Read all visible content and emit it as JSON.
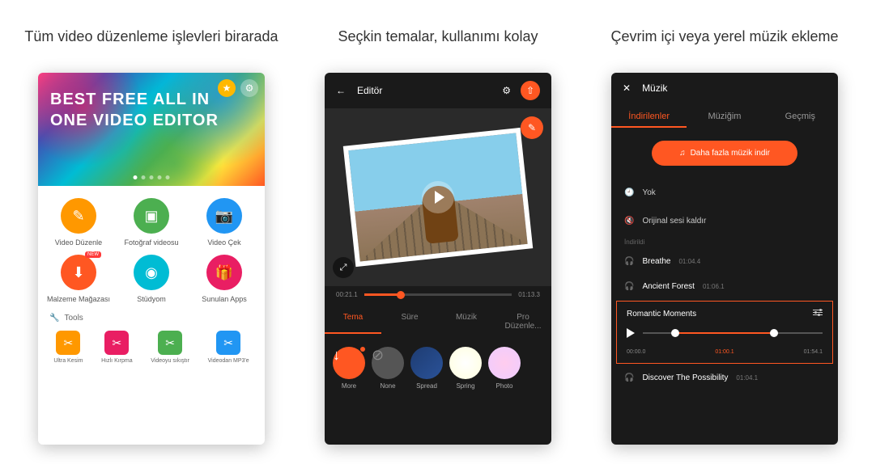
{
  "captions": {
    "c1": "Tüm video düzenleme işlevleri birarada",
    "c2": "Seçkin temalar, kullanımı kolay",
    "c3": "Çevrim içi veya yerel müzik ekleme"
  },
  "screen1": {
    "hero_line1": "BEST FREE ALL IN",
    "hero_line2": "ONE VIDEO EDITOR",
    "tiles": [
      {
        "label": "Video Düzenle",
        "color": "#ff9800",
        "icon": "pencil"
      },
      {
        "label": "Fotoğraf videosu",
        "color": "#4caf50",
        "icon": "image"
      },
      {
        "label": "Video Çek",
        "color": "#2196f3",
        "icon": "camera"
      },
      {
        "label": "Malzeme Mağazası",
        "color": "#ff5722",
        "icon": "download",
        "new": "NEW"
      },
      {
        "label": "Stüdyom",
        "color": "#00bcd4",
        "icon": "reel"
      },
      {
        "label": "Sunulan Apps",
        "color": "#e91e63",
        "icon": "gift"
      }
    ],
    "tools_header": "Tools",
    "tools": [
      {
        "label": "Ultra Kesim",
        "color": "#ff9800"
      },
      {
        "label": "Hızlı Kırpma",
        "color": "#e91e63"
      },
      {
        "label": "Videoyu sıkıştır",
        "color": "#4caf50"
      },
      {
        "label": "Videodan MP3'e",
        "color": "#2196f3"
      }
    ]
  },
  "screen2": {
    "title": "Editör",
    "time_start": "00:21.1",
    "time_end": "01:13.3",
    "tabs": [
      "Tema",
      "Süre",
      "Müzik",
      "Pro Düzenle..."
    ],
    "themes": [
      {
        "label": "More",
        "color": "#ff5722"
      },
      {
        "label": "None",
        "color": "#555"
      },
      {
        "label": "Spread",
        "color": "linear-gradient(135deg,#1e3c72,#2a5298)"
      },
      {
        "label": "Spring",
        "color": "radial-gradient(#fff,#ffd)"
      },
      {
        "label": "Photo",
        "color": "radial-gradient(#fce,#ecf)"
      }
    ]
  },
  "screen3": {
    "title": "Müzik",
    "tabs": [
      "İndirilenler",
      "Müziğim",
      "Geçmiş"
    ],
    "dl_button": "Daha fazla müzik indir",
    "opt_none": "Yok",
    "opt_remove": "Orijinal sesi kaldır",
    "sub": "İndirildi",
    "songs": [
      {
        "name": "Breathe",
        "time": "01:04.4"
      },
      {
        "name": "Ancient Forest",
        "time": "01:06.1"
      },
      {
        "name": "Discover The Possibility",
        "time": "01:04.1"
      }
    ],
    "player": {
      "name": "Romantic Moments",
      "t0": "00:00.0",
      "t1": "01:00.1",
      "t2": "01:54.1"
    }
  }
}
